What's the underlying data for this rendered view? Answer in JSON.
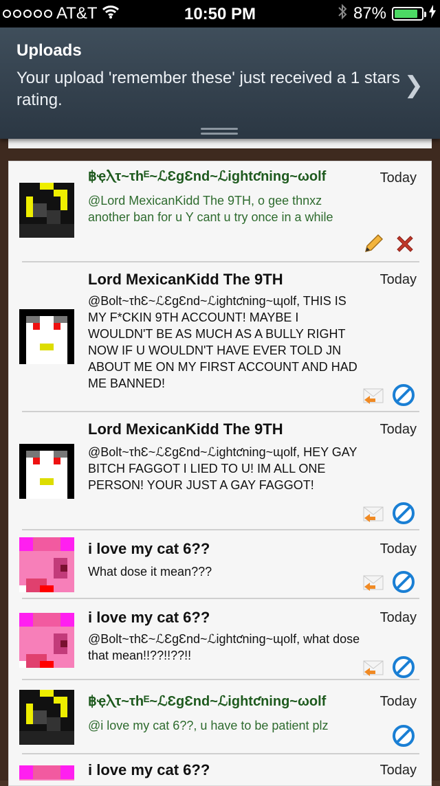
{
  "status_bar": {
    "carrier": "AT&T",
    "time": "10:50 PM",
    "battery": "87%"
  },
  "notification": {
    "title": "Uploads",
    "body": "Your upload 'remember these' just received a 1 stars rating."
  },
  "comments": [
    {
      "author": "฿ҿⲖτ~τhᴱ~ℒƐgƐnd~ℒightƈning~ωolf",
      "date": "Today",
      "text": "@Lord MexicanKidd The 9TH, o gee thnxz another ban for u Y cant u try once in a while",
      "green": true,
      "avatar": "black-yellow-wolf"
    },
    {
      "author": "Lord MexicanKidd The 9TH",
      "date": "Today",
      "text": "@Bolt~τhƐ~ℒƐgƐnd~ℒightƈning~ɰolf, THIS IS MY F*CKIN 9TH ACCOUNT! MAYBE I WOULDN'T BE AS MUCH AS A BULLY RIGHT NOW IF U WOULDN'T HAVE EVER TOLD JN ABOUT ME ON MY FIRST ACCOUNT AND HAD ME BANNED!",
      "green": false,
      "avatar": "white-face"
    },
    {
      "author": "Lord MexicanKidd The 9TH",
      "date": "Today",
      "text": "@Bolt~τhƐ~ℒƐgƐnd~ℒightƈning~ɰolf, HEY GAY BITCH FAGGOT I LIED TO U! IM ALL ONE PERSON! YOUR JUST A GAY FAGGOT!",
      "green": false,
      "avatar": "white-face"
    },
    {
      "author": "i love my cat 6??",
      "date": "Today",
      "text": "What dose it mean???",
      "green": false,
      "avatar": "pink-cat"
    },
    {
      "author": "i love my cat 6??",
      "date": "Today",
      "text": "@Bolt~τhƐ~ℒƐgƐnd~ℒightƈning~ɰolf, what dose that mean!!??!!??!!",
      "green": false,
      "avatar": "pink-cat"
    },
    {
      "author": "฿ҿⲖτ~τhᴱ~ℒƐgƐnd~ℒightƈning~ωolf",
      "date": "Today",
      "text": "@i love my cat 6??, u have to be patient plz",
      "green": true,
      "avatar": "black-yellow-wolf"
    },
    {
      "author": "i love my cat 6??",
      "date": "Today",
      "text": "",
      "green": false,
      "avatar": "pink-cat"
    }
  ],
  "icons": {
    "edit": "pencil-icon",
    "delete": "delete-x-icon",
    "reply": "reply-envelope-icon",
    "block": "block-icon"
  },
  "colors": {
    "green_text": "#2e6b2e",
    "banner": "#34414e",
    "delete": "#c0392b",
    "block": "#1a7fd4"
  }
}
